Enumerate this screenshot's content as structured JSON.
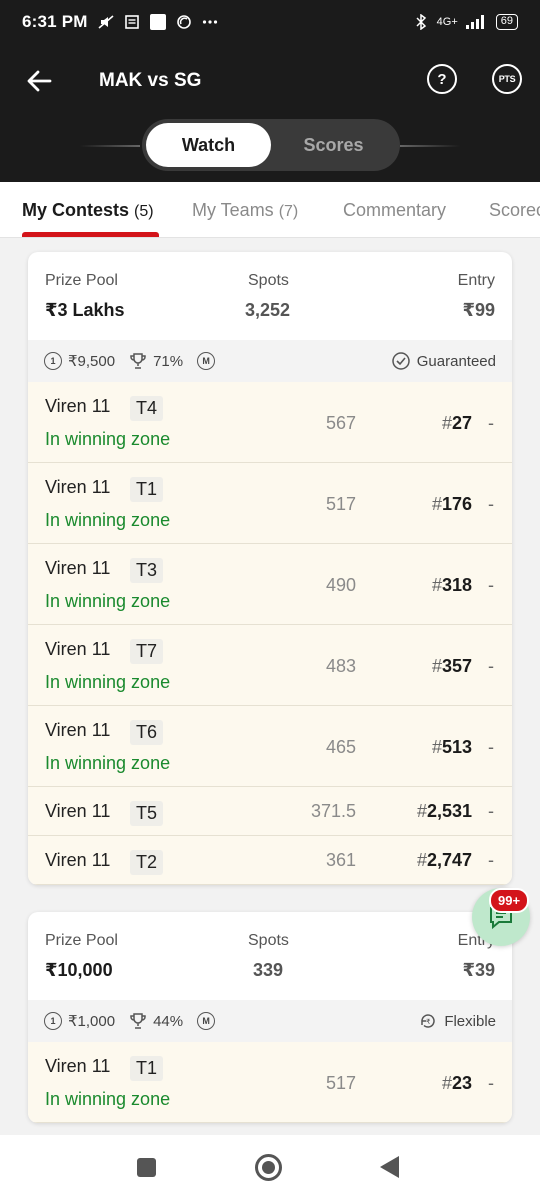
{
  "status_bar": {
    "time": "6:31 PM",
    "network": "4G+",
    "battery": "69"
  },
  "header": {
    "title": "MAK vs SG",
    "toggle": {
      "watch": "Watch",
      "scores": "Scores"
    },
    "pts_icon_label": "PTS"
  },
  "tabs": [
    {
      "label": "My Contests",
      "count": "(5)"
    },
    {
      "label": "My Teams",
      "count": "(7)"
    },
    {
      "label": "Commentary",
      "count": ""
    },
    {
      "label": "Scorecard",
      "count": ""
    }
  ],
  "contests": [
    {
      "prize_label": "Prize Pool",
      "prize": "₹3 Lakhs",
      "spots_label": "Spots",
      "spots": "3,252",
      "entry_label": "Entry",
      "entry": "₹99",
      "first_prize": "₹9,500",
      "win_pct": "71%",
      "multi": "M",
      "tag": "Guaranteed",
      "teams": [
        {
          "name": "Viren 11",
          "tag": "T4",
          "zone": "In winning zone",
          "points": "567",
          "rank": "27",
          "delta": "-"
        },
        {
          "name": "Viren 11",
          "tag": "T1",
          "zone": "In winning zone",
          "points": "517",
          "rank": "176",
          "delta": "-"
        },
        {
          "name": "Viren 11",
          "tag": "T3",
          "zone": "In winning zone",
          "points": "490",
          "rank": "318",
          "delta": "-"
        },
        {
          "name": "Viren 11",
          "tag": "T7",
          "zone": "In winning zone",
          "points": "483",
          "rank": "357",
          "delta": "-"
        },
        {
          "name": "Viren 11",
          "tag": "T6",
          "zone": "In winning zone",
          "points": "465",
          "rank": "513",
          "delta": "-"
        },
        {
          "name": "Viren 11",
          "tag": "T5",
          "zone": "",
          "points": "371.5",
          "rank": "2,531",
          "delta": "-"
        },
        {
          "name": "Viren 11",
          "tag": "T2",
          "zone": "",
          "points": "361",
          "rank": "2,747",
          "delta": "-"
        }
      ]
    },
    {
      "prize_label": "Prize Pool",
      "prize": "₹10,000",
      "spots_label": "Spots",
      "spots": "339",
      "entry_label": "Entry",
      "entry": "₹39",
      "first_prize": "₹1,000",
      "win_pct": "44%",
      "multi": "M",
      "tag": "Flexible",
      "teams": [
        {
          "name": "Viren 11",
          "tag": "T1",
          "zone": "In winning zone",
          "points": "517",
          "rank": "23",
          "delta": "-"
        }
      ]
    }
  ],
  "chat": {
    "badge": "99+"
  },
  "colors": {
    "accent_red": "#d3141a",
    "winning_green": "#1a8a2e",
    "header_bg": "#1b1b1b"
  }
}
